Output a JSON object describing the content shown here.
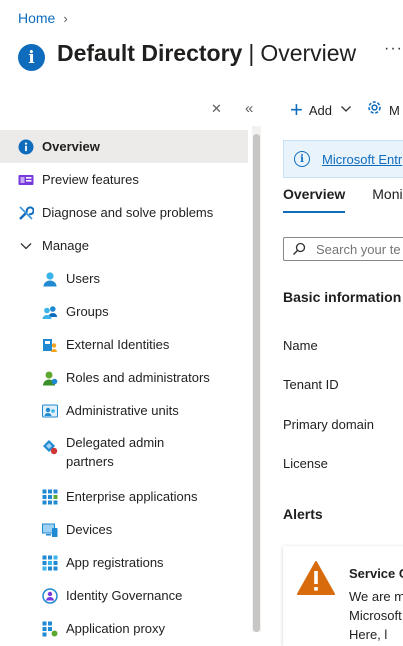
{
  "breadcrumb": {
    "home": "Home"
  },
  "header": {
    "title": "Default Directory",
    "separator": "|",
    "subtitle": "Overview",
    "more": "···"
  },
  "sidebar": {
    "items": [
      {
        "label": "Overview",
        "icon": "info-icon",
        "active": true
      },
      {
        "label": "Preview features",
        "icon": "preview-features-icon"
      },
      {
        "label": "Diagnose and solve problems",
        "icon": "tools-icon"
      },
      {
        "label": "Manage",
        "icon": "chevron-down-icon"
      },
      {
        "label": "Users",
        "icon": "user-icon"
      },
      {
        "label": "Groups",
        "icon": "groups-icon"
      },
      {
        "label": "External Identities",
        "icon": "external-identities-icon"
      },
      {
        "label": "Roles and administrators",
        "icon": "roles-icon"
      },
      {
        "label": "Administrative units",
        "icon": "admin-units-icon"
      },
      {
        "label": "Delegated admin",
        "label2": "partners",
        "icon": "delegated-admin-icon"
      },
      {
        "label": "Enterprise applications",
        "icon": "enterprise-apps-icon"
      },
      {
        "label": "Devices",
        "icon": "devices-icon"
      },
      {
        "label": "App registrations",
        "icon": "app-registrations-icon"
      },
      {
        "label": "Identity Governance",
        "icon": "identity-governance-icon"
      },
      {
        "label": "Application proxy",
        "icon": "application-proxy-icon"
      }
    ]
  },
  "toolbar": {
    "add_label": "Add",
    "manage_label": "M"
  },
  "banner": {
    "link_text": "Microsoft Entr"
  },
  "tabs": [
    {
      "label": "Overview",
      "active": true
    },
    {
      "label": "Moni"
    }
  ],
  "search": {
    "placeholder": "Search your te"
  },
  "basic_info": {
    "heading": "Basic information",
    "props": [
      "Name",
      "Tenant ID",
      "Primary domain",
      "License"
    ]
  },
  "alerts": {
    "heading": "Alerts",
    "card_title": "Service C",
    "card_line1": "We are m",
    "card_line2": "Microsoft",
    "card_line3": "Here, l"
  }
}
